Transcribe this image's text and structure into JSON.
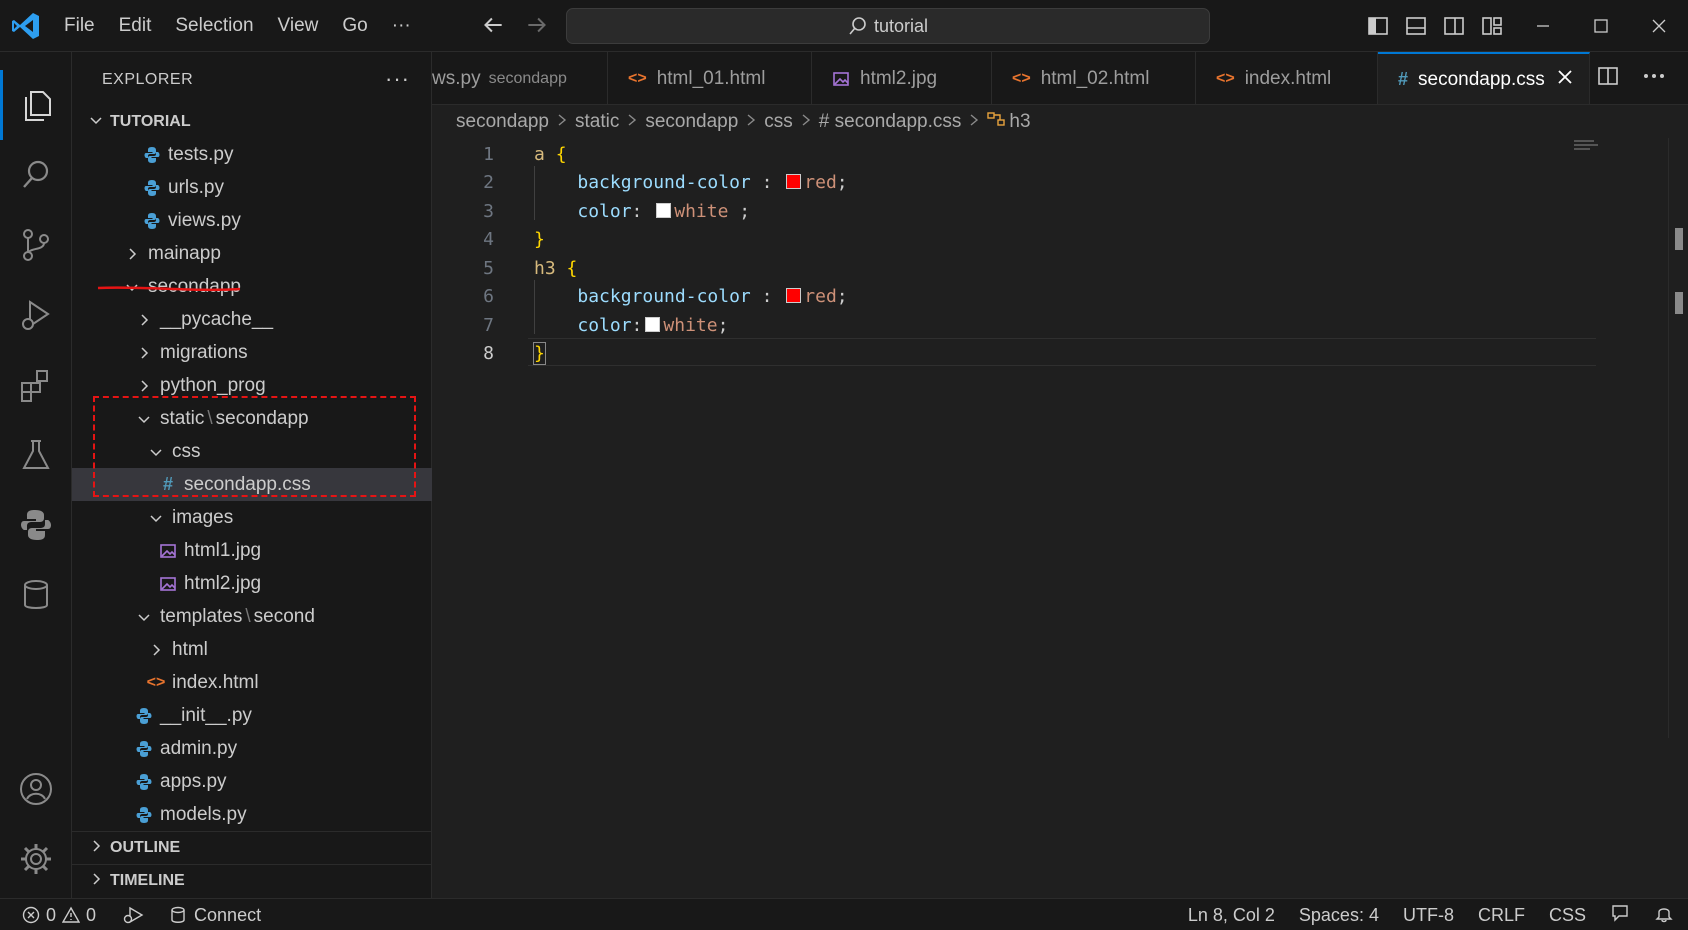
{
  "menu": [
    "File",
    "Edit",
    "Selection",
    "View",
    "Go",
    "···"
  ],
  "search_text": "tutorial",
  "explorer": {
    "title": "EXPLORER",
    "more": "···",
    "root": "TUTORIAL",
    "items": [
      {
        "label": "tests.py",
        "icon": "python-icon"
      },
      {
        "label": "urls.py",
        "icon": "python-icon"
      },
      {
        "label": "views.py",
        "icon": "python-icon"
      },
      {
        "label": "mainapp",
        "icon": "chevron-right-icon"
      },
      {
        "label": "secondapp",
        "icon": "chevron-down-icon"
      },
      {
        "label": "__pycache__",
        "icon": "chevron-right-icon"
      },
      {
        "label": "migrations",
        "icon": "chevron-right-icon"
      },
      {
        "label": "python_prog",
        "icon": "chevron-right-icon"
      },
      {
        "label": "static",
        "label2": "secondapp",
        "icon": "chevron-down-icon"
      },
      {
        "label": "css",
        "icon": "chevron-down-icon"
      },
      {
        "label": "secondapp.css",
        "icon": "css-icon"
      },
      {
        "label": "images",
        "icon": "chevron-down-icon"
      },
      {
        "label": "html1.jpg",
        "icon": "image-icon"
      },
      {
        "label": "html2.jpg",
        "icon": "image-icon"
      },
      {
        "label": "templates",
        "label2": "second",
        "icon": "chevron-down-icon"
      },
      {
        "label": "html",
        "icon": "chevron-right-icon"
      },
      {
        "label": "index.html",
        "icon": "html-icon"
      },
      {
        "label": "__init__.py",
        "icon": "python-icon"
      },
      {
        "label": "admin.py",
        "icon": "python-icon"
      },
      {
        "label": "apps.py",
        "icon": "python-icon"
      },
      {
        "label": "models.py",
        "icon": "python-icon"
      }
    ],
    "outline": "OUTLINE",
    "timeline": "TIMELINE"
  },
  "tabs": [
    {
      "label": "ws.py",
      "desc": "secondapp",
      "icon": "none"
    },
    {
      "label": "html_01.html",
      "icon": "html-icon"
    },
    {
      "label": "html2.jpg",
      "icon": "image-icon"
    },
    {
      "label": "html_02.html",
      "icon": "html-icon"
    },
    {
      "label": "index.html",
      "icon": "html-icon"
    },
    {
      "label": "secondapp.css",
      "icon": "css-icon",
      "active": true
    }
  ],
  "breadcrumb": [
    "secondapp",
    "static",
    "secondapp",
    "css",
    "# secondapp.css",
    "h3"
  ],
  "code": {
    "line_numbers": [
      "1",
      "2",
      "3",
      "4",
      "5",
      "6",
      "7",
      "8"
    ],
    "current_line": 8,
    "lines": [
      {
        "sel": "a",
        "brace": "{"
      },
      {
        "prop": "background-color",
        "colon": " : ",
        "swatch": "#ff0000",
        "val": "red",
        "end": ";"
      },
      {
        "prop": "color",
        "colon": ": ",
        "swatch": "#ffffff",
        "val": "white",
        "end": " ;"
      },
      {
        "brace": "}"
      },
      {
        "sel": "h3",
        "brace": "{"
      },
      {
        "prop": "background-color",
        "colon": " : ",
        "swatch": "#ff0000",
        "val": "red",
        "end": ";"
      },
      {
        "prop": "color",
        "colon": ":",
        "swatch": "#ffffff",
        "val": "white",
        "end": ";"
      },
      {
        "brace": "}"
      }
    ]
  },
  "status": {
    "errors": "0",
    "warnings": "0",
    "connect": "Connect",
    "position": "Ln 8, Col 2",
    "spaces": "Spaces: 4",
    "encoding": "UTF-8",
    "eol": "CRLF",
    "language": "CSS"
  },
  "colors": {
    "accent": "#0078d4",
    "annotation_red": "#e51414",
    "python_icon": "#4a9fd5",
    "html_icon": "#e8742e",
    "image_icon": "#a574d6",
    "css_icon": "#519aba"
  }
}
